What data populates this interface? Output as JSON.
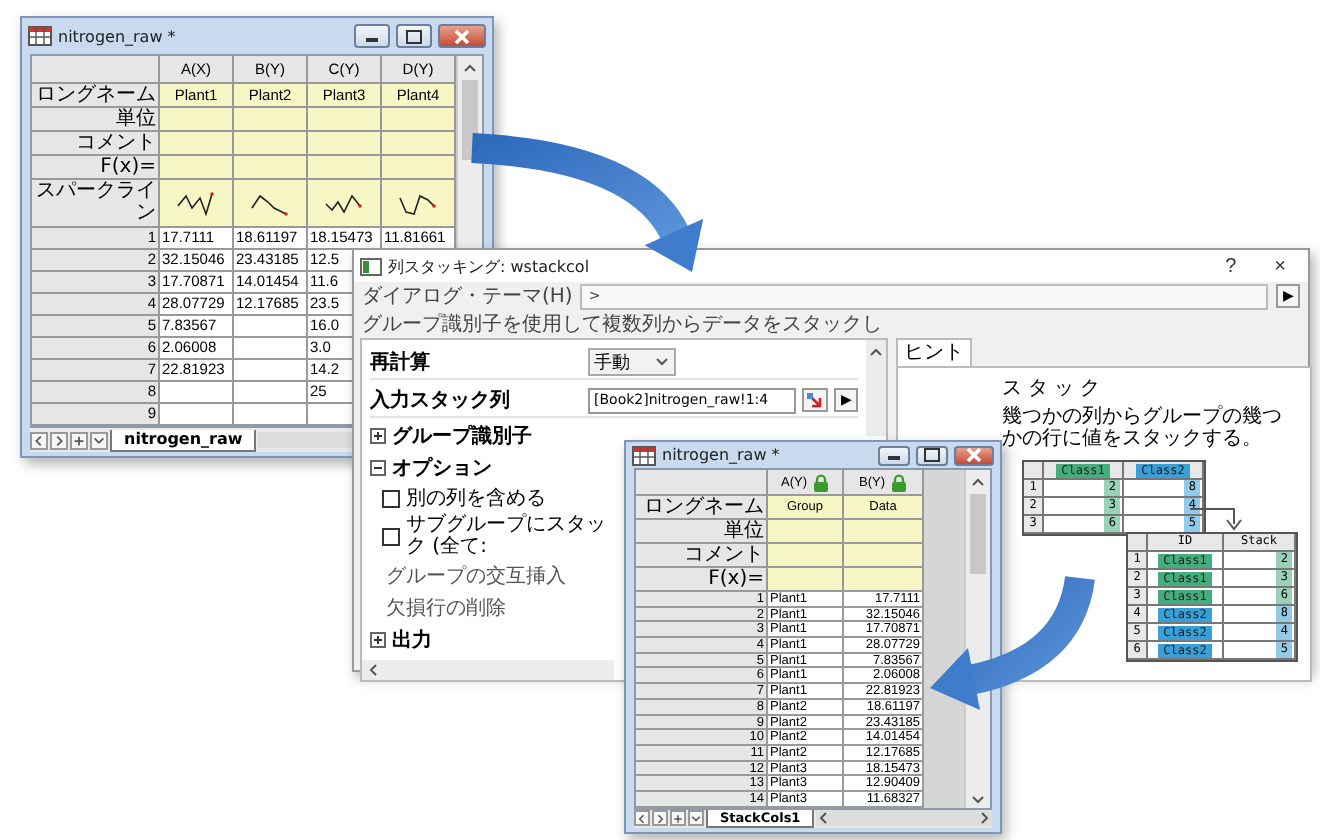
{
  "worksheet_top": {
    "title": "nitrogen_raw *",
    "columns": [
      {
        "label": "A(X)",
        "locked": false
      },
      {
        "label": "B(Y)",
        "locked": false
      },
      {
        "label": "C(Y)",
        "locked": false
      },
      {
        "label": "D(Y)",
        "locked": false
      }
    ],
    "header_rows": [
      {
        "label": "ロングネーム",
        "cells": [
          "Plant1",
          "Plant2",
          "Plant3",
          "Plant4"
        ]
      },
      {
        "label": "単位"
      },
      {
        "label": "コメント"
      },
      {
        "label": "F(x)="
      }
    ],
    "sparkline_row": {
      "label": "スパークライン"
    },
    "rows": [
      {
        "label": "1",
        "cells": [
          "17.7111",
          "18.61197",
          "18.15473",
          "11.81661"
        ]
      },
      {
        "label": "2",
        "cells": [
          "32.15046",
          "23.43185",
          "12.5",
          null
        ]
      },
      {
        "label": "3",
        "cells": [
          "17.70871",
          "14.01454",
          "11.6",
          null
        ]
      },
      {
        "label": "4",
        "cells": [
          "28.07729",
          "12.17685",
          "23.5",
          null
        ]
      },
      {
        "label": "5",
        "cells": [
          "7.83567",
          null,
          "16.0",
          null
        ]
      },
      {
        "label": "6",
        "cells": [
          "2.06008",
          null,
          "3.0",
          null
        ]
      },
      {
        "label": "7",
        "cells": [
          "22.81923",
          null,
          "14.2",
          null
        ]
      },
      {
        "label": "8",
        "cells": [
          null,
          null,
          "25",
          null
        ]
      },
      {
        "label": "9",
        "cells": [
          null,
          null,
          null,
          null
        ]
      }
    ],
    "sheet_tab": "nitrogen_raw"
  },
  "dialog": {
    "title": "列スタッキング: wstackcol",
    "help": "?",
    "close": "×",
    "theme_label": "ダイアログ・テーマ(H)",
    "theme_value": ">",
    "theme_button": "▶",
    "description": "グループ識別子を使用して複数列からデータをスタックし",
    "recalc": {
      "label": "再計算",
      "value": "手動"
    },
    "input": {
      "label": "入力スタック列",
      "value": "[Book2]nitrogen_raw!1:4",
      "button": "▶"
    },
    "tree": [
      {
        "kind": "group",
        "label": "グループ識別子",
        "expanded": false
      },
      {
        "kind": "group",
        "label": "オプション",
        "expanded": true,
        "children": [
          {
            "kind": "checkbox",
            "label": "別の列を含める",
            "checked": false
          },
          {
            "kind": "checkbox",
            "label": "サブグループにスタック (全て:",
            "checked": false
          },
          {
            "kind": "text",
            "label": "グループの交互挿入"
          },
          {
            "kind": "text",
            "label": "欠損行の削除"
          }
        ]
      },
      {
        "kind": "group",
        "label": "出力",
        "expanded": false
      }
    ],
    "hint": {
      "tab": "ヒント",
      "title": "スタック",
      "text": "幾つかの列からグループの幾つかの行に値をスタックする。",
      "source_table": {
        "columns": [
          {
            "label": "Class1",
            "color": "#45ad7d"
          },
          {
            "label": "Class2",
            "color": "#3a9fd6"
          }
        ],
        "rows": [
          {
            "label": "1",
            "values": [
              "2",
              "8"
            ]
          },
          {
            "label": "2",
            "values": [
              "3",
              "4"
            ]
          },
          {
            "label": "3",
            "values": [
              "6",
              "5"
            ]
          }
        ]
      },
      "result_table": {
        "columns": [
          "ID",
          "Stack"
        ],
        "rows": [
          {
            "label": "1",
            "id": "Class1",
            "value": "2",
            "color": "#45ad7d"
          },
          {
            "label": "2",
            "id": "Class1",
            "value": "3",
            "color": "#45ad7d"
          },
          {
            "label": "3",
            "id": "Class1",
            "value": "6",
            "color": "#45ad7d"
          },
          {
            "label": "4",
            "id": "Class2",
            "value": "8",
            "color": "#3a9fd6"
          },
          {
            "label": "5",
            "id": "Class2",
            "value": "4",
            "color": "#3a9fd6"
          },
          {
            "label": "6",
            "id": "Class2",
            "value": "5",
            "color": "#3a9fd6"
          }
        ]
      }
    }
  },
  "worksheet_result": {
    "title": "nitrogen_raw *",
    "columns": [
      {
        "label": "A(Y)",
        "kind": "text",
        "locked": true
      },
      {
        "label": "B(Y)",
        "kind": "number",
        "locked": true
      }
    ],
    "header_rows": [
      {
        "label": "ロングネーム",
        "cells": [
          "Group",
          "Data"
        ]
      },
      {
        "label": "単位"
      },
      {
        "label": "コメント"
      },
      {
        "label": "F(x)="
      }
    ],
    "rows": [
      {
        "label": "1",
        "cells": [
          "Plant1",
          "17.7111"
        ]
      },
      {
        "label": "2",
        "cells": [
          "Plant1",
          "32.15046"
        ]
      },
      {
        "label": "3",
        "cells": [
          "Plant1",
          "17.70871"
        ]
      },
      {
        "label": "4",
        "cells": [
          "Plant1",
          "28.07729"
        ]
      },
      {
        "label": "5",
        "cells": [
          "Plant1",
          "7.83567"
        ]
      },
      {
        "label": "6",
        "cells": [
          "Plant1",
          "2.06008"
        ]
      },
      {
        "label": "7",
        "cells": [
          "Plant1",
          "22.81923"
        ]
      },
      {
        "label": "8",
        "cells": [
          "Plant2",
          "18.61197"
        ]
      },
      {
        "label": "9",
        "cells": [
          "Plant2",
          "23.43185"
        ]
      },
      {
        "label": "10",
        "cells": [
          "Plant2",
          "14.01454"
        ]
      },
      {
        "label": "11",
        "cells": [
          "Plant2",
          "12.17685"
        ]
      },
      {
        "label": "12",
        "cells": [
          "Plant3",
          "18.15473"
        ]
      },
      {
        "label": "13",
        "cells": [
          "Plant3",
          "12.90409"
        ]
      },
      {
        "label": "14",
        "cells": [
          "Plant3",
          "11.68327"
        ]
      }
    ],
    "sheet_tab": "StackCols1"
  }
}
